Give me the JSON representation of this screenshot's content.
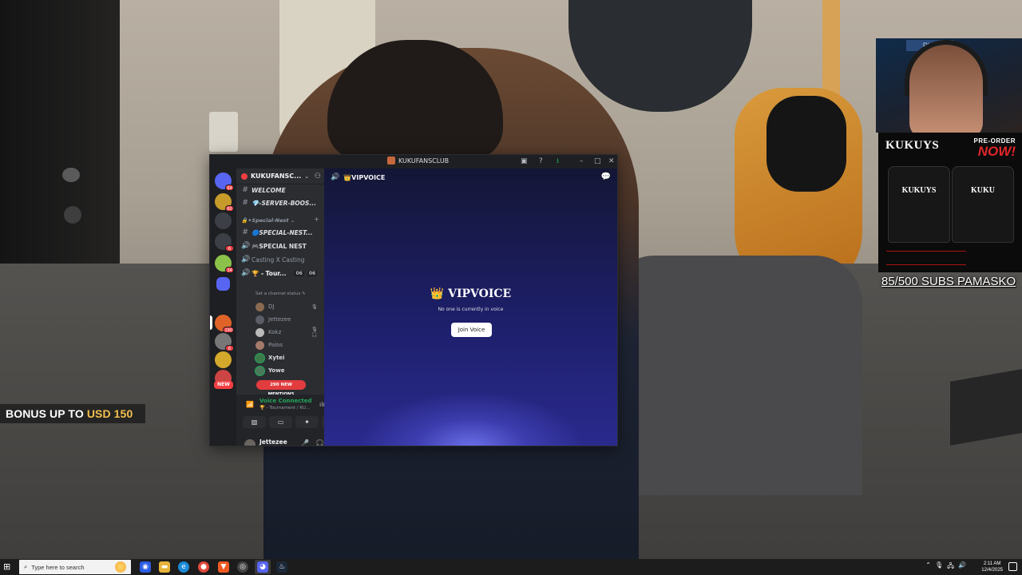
{
  "overlay": {
    "bonus_prefix": "BONUS UP TO",
    "bonus_amount": "USD 150",
    "subs_text": "85/500 SUBS PAMASKO",
    "webcam_sign": "PHP",
    "ad": {
      "brand": "KUKUYS",
      "preorder": "PRE-ORDER",
      "now": "NOW!",
      "shirt1_text": "KUKUYS",
      "shirt2_text": "KUKU"
    }
  },
  "discord": {
    "window_title": "KUKUFANSCLUB",
    "title_buttons": [
      "▣",
      "?",
      "⭳",
      "–",
      "□",
      "✕"
    ],
    "server_name": "KUKUFANSC...",
    "server_badges": [
      "64",
      "60",
      "",
      "6",
      "34",
      "290",
      "6",
      ""
    ],
    "new_label": "NEW",
    "channels": {
      "welcome": "𝙒𝙀𝙇𝘾𝙊𝙈𝙀",
      "server_boost": "💎-SERVER-BOOS...",
      "category_special": "🔒✦Special-Nest ⌄",
      "special_nest_text": "🔵SPECIAL-NEST...",
      "special_nest_voice": "🎮SPECIAL NEST",
      "casting": "Casting X Casting",
      "tournament": "🏆 - Tour...",
      "tournament_count_a": "06",
      "tournament_count_b": "06",
      "status_hint": "Set a channel status ✎"
    },
    "members": [
      {
        "name": "DJ",
        "online": false
      },
      {
        "name": "Jettezee",
        "online": false
      },
      {
        "name": "Kokz",
        "online": false
      },
      {
        "name": "Palos",
        "online": false
      },
      {
        "name": "Xytei",
        "online": true
      },
      {
        "name": "Yowe",
        "online": true
      }
    ],
    "mentions_label": "290 NEW MENTIONS",
    "voice": {
      "status": "Voice Connected",
      "location": "🏆 - Tournament / KU..."
    },
    "user": {
      "name": "Jettezee",
      "tag": "jettezee"
    },
    "main": {
      "channel_name": "👑VIPVOICE",
      "title": "👑 VIPVOICE",
      "subtitle": "No one is currently in voice",
      "join_label": "Join Voice"
    }
  },
  "taskbar": {
    "search_placeholder": "Type here to search",
    "time": "2:11 AM",
    "date": "12/4/2025"
  },
  "icons": {
    "start": "windows-logo-icon",
    "search": "magnifier-icon",
    "settings": "gear-icon",
    "mic": "microphone-icon"
  }
}
